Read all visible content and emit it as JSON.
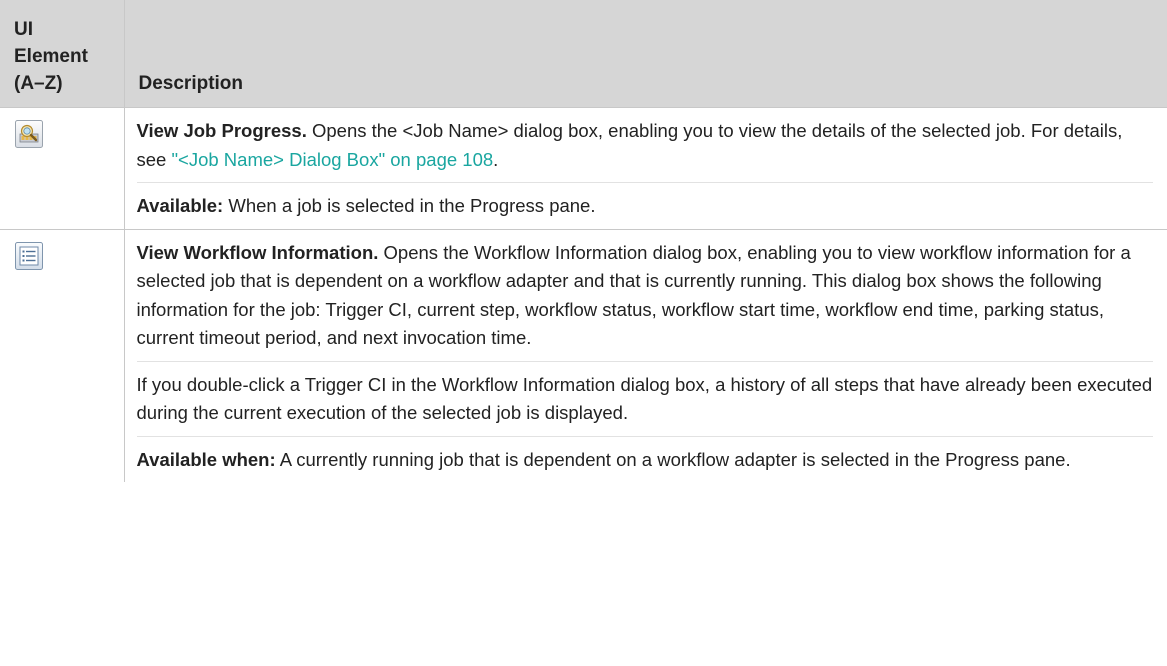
{
  "table": {
    "headers": {
      "element": "UI Element (A–Z)",
      "description": "Description"
    },
    "rows": [
      {
        "icon": "view-job-progress-icon",
        "paragraphs": [
          {
            "bold": "View Job Progress.",
            "text_before_link": " Opens the <Job Name> dialog box, enabling you to view the details of the selected job. For details, see ",
            "link": "\"<Job Name> Dialog Box\" on page 108",
            "text_after_link": "."
          },
          {
            "bold": "Available:",
            "text": " When a job is selected in the Progress pane."
          }
        ]
      },
      {
        "icon": "view-workflow-information-icon",
        "paragraphs": [
          {
            "bold": "View Workflow Information.",
            "text": " Opens the Workflow Information dialog box, enabling you to view workflow information for a selected job that is dependent on a workflow adapter and that is currently running. This dialog box shows the following information for the job: Trigger CI, current step, workflow status, workflow start time, workflow end time, parking status, current timeout period, and next invocation time."
          },
          {
            "text": "If you double-click a Trigger CI in the Workflow Information dialog box, a history of all steps that have already been executed during the current execution of the selected job is displayed."
          },
          {
            "bold": "Available when:",
            "text": " A currently running job that is dependent on a workflow adapter is selected in the Progress pane."
          }
        ]
      }
    ]
  },
  "colors": {
    "header_bg": "#d6d6d6",
    "border": "#c8c8c8",
    "link": "#1aa6a0",
    "text": "#222222"
  }
}
